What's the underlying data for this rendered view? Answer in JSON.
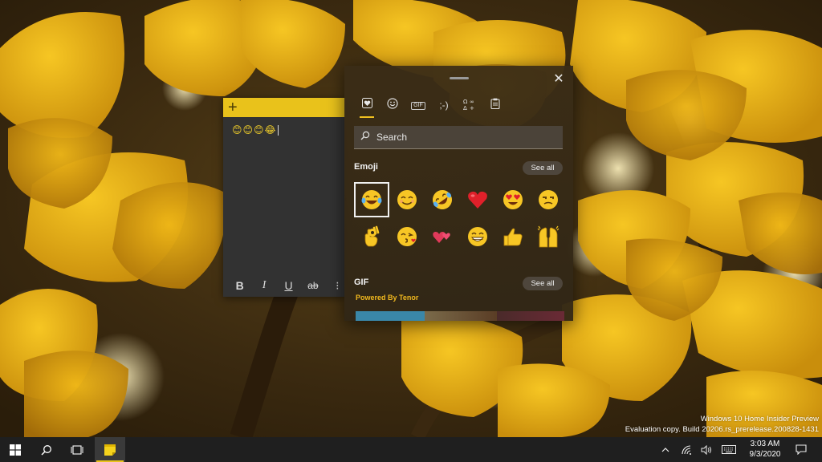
{
  "sticky_note": {
    "add_label": "+",
    "content": "😊😊😊😂",
    "toolbar": {
      "bold": "B",
      "italic": "I",
      "underline": "U",
      "strikethrough": "ab",
      "list": "⁝"
    }
  },
  "emoji_panel": {
    "close_label": "✕",
    "tabs": [
      {
        "name": "recent",
        "icon": "heart-recent-icon",
        "glyph": "♥"
      },
      {
        "name": "emoji",
        "icon": "smiley-icon",
        "glyph": "☺"
      },
      {
        "name": "gif",
        "icon": "gif-icon",
        "glyph": "GIF"
      },
      {
        "name": "kaomoji",
        "icon": "kaomoji-icon",
        "glyph": ";-)"
      },
      {
        "name": "symbols",
        "icon": "symbols-icon",
        "glyph": "Ω"
      },
      {
        "name": "clipboard",
        "icon": "clipboard-icon",
        "glyph": "📋"
      }
    ],
    "search_placeholder": "Search",
    "emoji_section": {
      "title": "Emoji",
      "see_all": "See all",
      "items": [
        {
          "name": "tears-of-joy-emoji"
        },
        {
          "name": "smiling-face-emoji"
        },
        {
          "name": "rolling-laughing-emoji"
        },
        {
          "name": "red-heart-emoji"
        },
        {
          "name": "heart-eyes-emoji"
        },
        {
          "name": "unamused-face-emoji"
        },
        {
          "name": "ok-hand-emoji"
        },
        {
          "name": "kissing-face-emoji"
        },
        {
          "name": "two-hearts-emoji"
        },
        {
          "name": "grinning-face-emoji"
        },
        {
          "name": "thumbs-up-emoji"
        },
        {
          "name": "raising-hands-emoji"
        }
      ]
    },
    "gif_section": {
      "title": "GIF",
      "see_all": "See all",
      "powered_by": "Powered By Tenor"
    }
  },
  "watermark": {
    "line1": "Windows 10 Home Insider Preview",
    "line2": "Evaluation copy. Build 20206.rs_prerelease.200828-1431"
  },
  "taskbar": {
    "time": "3:03 AM",
    "date": "9/3/2020"
  },
  "colors": {
    "accent": "#e9c21b",
    "panel_bg": "#3a2c16",
    "taskbar_bg": "#1f1f1f"
  }
}
